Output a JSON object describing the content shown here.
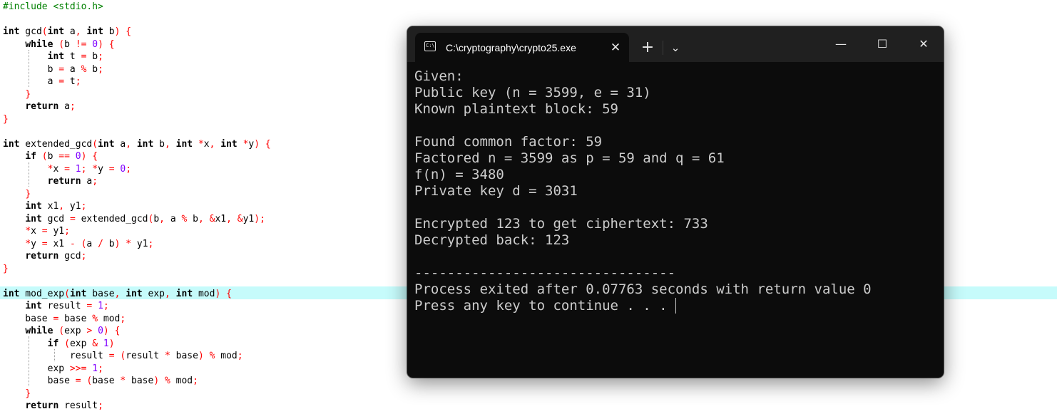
{
  "editor": {
    "lines": [
      {
        "tokens": [
          [
            "#include <stdio.h>",
            "pre"
          ]
        ]
      },
      {
        "tokens": []
      },
      {
        "tokens": [
          [
            "int",
            "kw"
          ],
          [
            " gcd",
            "fn"
          ],
          [
            "(",
            "op"
          ],
          [
            "int",
            "kw"
          ],
          [
            " a",
            "id"
          ],
          [
            ",",
            "op"
          ],
          [
            " ",
            "id"
          ],
          [
            "int",
            "kw"
          ],
          [
            " b",
            "id"
          ],
          [
            ")",
            "op"
          ],
          [
            " ",
            "id"
          ],
          [
            "{",
            "op"
          ]
        ]
      },
      {
        "tokens": [
          [
            "    ",
            "id"
          ],
          [
            "while",
            "kw"
          ],
          [
            " ",
            "id"
          ],
          [
            "(",
            "op"
          ],
          [
            "b ",
            "id"
          ],
          [
            "!=",
            "op"
          ],
          [
            " ",
            "id"
          ],
          [
            "0",
            "num"
          ],
          [
            ")",
            "op"
          ],
          [
            " ",
            "id"
          ],
          [
            "{",
            "op"
          ]
        ]
      },
      {
        "tokens": [
          [
            "        ",
            "id"
          ],
          [
            "int",
            "kw"
          ],
          [
            " t ",
            "id"
          ],
          [
            "=",
            "op"
          ],
          [
            " b",
            "id"
          ],
          [
            ";",
            "op"
          ]
        ]
      },
      {
        "tokens": [
          [
            "        b ",
            "id"
          ],
          [
            "=",
            "op"
          ],
          [
            " a ",
            "id"
          ],
          [
            "%",
            "op"
          ],
          [
            " b",
            "id"
          ],
          [
            ";",
            "op"
          ]
        ]
      },
      {
        "tokens": [
          [
            "        a ",
            "id"
          ],
          [
            "=",
            "op"
          ],
          [
            " t",
            "id"
          ],
          [
            ";",
            "op"
          ]
        ]
      },
      {
        "tokens": [
          [
            "    ",
            "id"
          ],
          [
            "}",
            "op"
          ]
        ]
      },
      {
        "tokens": [
          [
            "    ",
            "id"
          ],
          [
            "return",
            "kw"
          ],
          [
            " a",
            "id"
          ],
          [
            ";",
            "op"
          ]
        ]
      },
      {
        "tokens": [
          [
            "}",
            "op"
          ]
        ]
      },
      {
        "tokens": []
      },
      {
        "tokens": [
          [
            "int",
            "kw"
          ],
          [
            " extended_gcd",
            "fn"
          ],
          [
            "(",
            "op"
          ],
          [
            "int",
            "kw"
          ],
          [
            " a",
            "id"
          ],
          [
            ",",
            "op"
          ],
          [
            " ",
            "id"
          ],
          [
            "int",
            "kw"
          ],
          [
            " b",
            "id"
          ],
          [
            ",",
            "op"
          ],
          [
            " ",
            "id"
          ],
          [
            "int",
            "kw"
          ],
          [
            " ",
            "id"
          ],
          [
            "*",
            "op"
          ],
          [
            "x",
            "id"
          ],
          [
            ",",
            "op"
          ],
          [
            " ",
            "id"
          ],
          [
            "int",
            "kw"
          ],
          [
            " ",
            "id"
          ],
          [
            "*",
            "op"
          ],
          [
            "y",
            "id"
          ],
          [
            ")",
            "op"
          ],
          [
            " ",
            "id"
          ],
          [
            "{",
            "op"
          ]
        ]
      },
      {
        "tokens": [
          [
            "    ",
            "id"
          ],
          [
            "if",
            "kw"
          ],
          [
            " ",
            "id"
          ],
          [
            "(",
            "op"
          ],
          [
            "b ",
            "id"
          ],
          [
            "==",
            "op"
          ],
          [
            " ",
            "id"
          ],
          [
            "0",
            "num"
          ],
          [
            ")",
            "op"
          ],
          [
            " ",
            "id"
          ],
          [
            "{",
            "op"
          ]
        ]
      },
      {
        "tokens": [
          [
            "        ",
            "id"
          ],
          [
            "*",
            "op"
          ],
          [
            "x ",
            "id"
          ],
          [
            "=",
            "op"
          ],
          [
            " ",
            "id"
          ],
          [
            "1",
            "num"
          ],
          [
            ";",
            "op"
          ],
          [
            " ",
            "id"
          ],
          [
            "*",
            "op"
          ],
          [
            "y ",
            "id"
          ],
          [
            "=",
            "op"
          ],
          [
            " ",
            "id"
          ],
          [
            "0",
            "num"
          ],
          [
            ";",
            "op"
          ]
        ]
      },
      {
        "tokens": [
          [
            "        ",
            "id"
          ],
          [
            "return",
            "kw"
          ],
          [
            " a",
            "id"
          ],
          [
            ";",
            "op"
          ]
        ]
      },
      {
        "tokens": [
          [
            "    ",
            "id"
          ],
          [
            "}",
            "op"
          ]
        ]
      },
      {
        "tokens": [
          [
            "    ",
            "id"
          ],
          [
            "int",
            "kw"
          ],
          [
            " x1",
            "id"
          ],
          [
            ",",
            "op"
          ],
          [
            " y1",
            "id"
          ],
          [
            ";",
            "op"
          ]
        ]
      },
      {
        "tokens": [
          [
            "    ",
            "id"
          ],
          [
            "int",
            "kw"
          ],
          [
            " gcd ",
            "id"
          ],
          [
            "=",
            "op"
          ],
          [
            " extended_gcd",
            "fn"
          ],
          [
            "(",
            "op"
          ],
          [
            "b",
            "id"
          ],
          [
            ",",
            "op"
          ],
          [
            " a ",
            "id"
          ],
          [
            "%",
            "op"
          ],
          [
            " b",
            "id"
          ],
          [
            ",",
            "op"
          ],
          [
            " ",
            "id"
          ],
          [
            "&",
            "op"
          ],
          [
            "x1",
            "id"
          ],
          [
            ",",
            "op"
          ],
          [
            " ",
            "id"
          ],
          [
            "&",
            "op"
          ],
          [
            "y1",
            "id"
          ],
          [
            ")",
            "op"
          ],
          [
            ";",
            "op"
          ]
        ]
      },
      {
        "tokens": [
          [
            "    ",
            "id"
          ],
          [
            "*",
            "op"
          ],
          [
            "x ",
            "id"
          ],
          [
            "=",
            "op"
          ],
          [
            " y1",
            "id"
          ],
          [
            ";",
            "op"
          ]
        ]
      },
      {
        "tokens": [
          [
            "    ",
            "id"
          ],
          [
            "*",
            "op"
          ],
          [
            "y ",
            "id"
          ],
          [
            "=",
            "op"
          ],
          [
            " x1 ",
            "id"
          ],
          [
            "-",
            "op"
          ],
          [
            " ",
            "id"
          ],
          [
            "(",
            "op"
          ],
          [
            "a ",
            "id"
          ],
          [
            "/",
            "op"
          ],
          [
            " b",
            "id"
          ],
          [
            ")",
            "op"
          ],
          [
            " ",
            "id"
          ],
          [
            "*",
            "op"
          ],
          [
            " y1",
            "id"
          ],
          [
            ";",
            "op"
          ]
        ]
      },
      {
        "tokens": [
          [
            "    ",
            "id"
          ],
          [
            "return",
            "kw"
          ],
          [
            " gcd",
            "id"
          ],
          [
            ";",
            "op"
          ]
        ]
      },
      {
        "tokens": [
          [
            "}",
            "op"
          ]
        ]
      },
      {
        "tokens": []
      },
      {
        "tokens": [
          [
            "int",
            "kw"
          ],
          [
            " mod_exp",
            "fn"
          ],
          [
            "(",
            "op"
          ],
          [
            "int",
            "kw"
          ],
          [
            " base",
            "id"
          ],
          [
            ",",
            "op"
          ],
          [
            " ",
            "id"
          ],
          [
            "int",
            "kw"
          ],
          [
            " exp",
            "id"
          ],
          [
            ",",
            "op"
          ],
          [
            " ",
            "id"
          ],
          [
            "int",
            "kw"
          ],
          [
            " mod",
            "id"
          ],
          [
            ")",
            "op"
          ],
          [
            " ",
            "id"
          ],
          [
            "{",
            "op"
          ]
        ]
      },
      {
        "tokens": [
          [
            "    ",
            "id"
          ],
          [
            "int",
            "kw"
          ],
          [
            " result ",
            "id"
          ],
          [
            "=",
            "op"
          ],
          [
            " ",
            "id"
          ],
          [
            "1",
            "num"
          ],
          [
            ";",
            "op"
          ]
        ]
      },
      {
        "tokens": [
          [
            "    base ",
            "id"
          ],
          [
            "=",
            "op"
          ],
          [
            " base ",
            "id"
          ],
          [
            "%",
            "op"
          ],
          [
            " mod",
            "id"
          ],
          [
            ";",
            "op"
          ]
        ]
      },
      {
        "tokens": [
          [
            "    ",
            "id"
          ],
          [
            "while",
            "kw"
          ],
          [
            " ",
            "id"
          ],
          [
            "(",
            "op"
          ],
          [
            "exp ",
            "id"
          ],
          [
            ">",
            "op"
          ],
          [
            " ",
            "id"
          ],
          [
            "0",
            "num"
          ],
          [
            ")",
            "op"
          ],
          [
            " ",
            "id"
          ],
          [
            "{",
            "op"
          ]
        ]
      },
      {
        "tokens": [
          [
            "        ",
            "id"
          ],
          [
            "if",
            "kw"
          ],
          [
            " ",
            "id"
          ],
          [
            "(",
            "op"
          ],
          [
            "exp ",
            "id"
          ],
          [
            "&",
            "op"
          ],
          [
            " ",
            "id"
          ],
          [
            "1",
            "num"
          ],
          [
            ")",
            "op"
          ]
        ]
      },
      {
        "tokens": [
          [
            "            result ",
            "id"
          ],
          [
            "=",
            "op"
          ],
          [
            " ",
            "id"
          ],
          [
            "(",
            "op"
          ],
          [
            "result ",
            "id"
          ],
          [
            "*",
            "op"
          ],
          [
            " base",
            "id"
          ],
          [
            ")",
            "op"
          ],
          [
            " ",
            "id"
          ],
          [
            "%",
            "op"
          ],
          [
            " mod",
            "id"
          ],
          [
            ";",
            "op"
          ]
        ]
      },
      {
        "tokens": [
          [
            "        exp ",
            "id"
          ],
          [
            ">>=",
            "op"
          ],
          [
            " ",
            "id"
          ],
          [
            "1",
            "num"
          ],
          [
            ";",
            "op"
          ]
        ]
      },
      {
        "tokens": [
          [
            "        base ",
            "id"
          ],
          [
            "=",
            "op"
          ],
          [
            " ",
            "id"
          ],
          [
            "(",
            "op"
          ],
          [
            "base ",
            "id"
          ],
          [
            "*",
            "op"
          ],
          [
            " base",
            "id"
          ],
          [
            ")",
            "op"
          ],
          [
            " ",
            "id"
          ],
          [
            "%",
            "op"
          ],
          [
            " mod",
            "id"
          ],
          [
            ";",
            "op"
          ]
        ]
      },
      {
        "tokens": [
          [
            "    ",
            "id"
          ],
          [
            "}",
            "op"
          ]
        ]
      },
      {
        "tokens": [
          [
            "    ",
            "id"
          ],
          [
            "return",
            "kw"
          ],
          [
            " result",
            "id"
          ],
          [
            ";",
            "op"
          ]
        ]
      }
    ]
  },
  "terminal": {
    "tab_title": "C:\\cryptography\\crypto25.exe",
    "tab_icon_text": "C:\\",
    "tab_close_glyph": "✕",
    "new_tab_glyph": "+",
    "dropdown_glyph": "⌄",
    "minimize_glyph": "—",
    "maximize_glyph": "☐",
    "close_glyph": "✕",
    "output": [
      "Given:",
      "Public key (n = 3599, e = 31)",
      "Known plaintext block: 59",
      "",
      "Found common factor: 59",
      "Factored n = 3599 as p = 59 and q = 61",
      "f(n) = 3480",
      "Private key d = 3031",
      "",
      "Encrypted 123 to get ciphertext: 733",
      "Decrypted back: 123",
      "",
      "--------------------------------",
      "Process exited after 0.07763 seconds with return value 0",
      "Press any key to continue . . . "
    ]
  },
  "colors": {
    "keyword": "#000000",
    "preprocessor": "#008000",
    "number": "#8000ff",
    "operator": "#ff0000",
    "current_line": "#c6fbfb",
    "terminal_bg": "#0c0c0c",
    "terminal_fg": "#cccccc"
  }
}
